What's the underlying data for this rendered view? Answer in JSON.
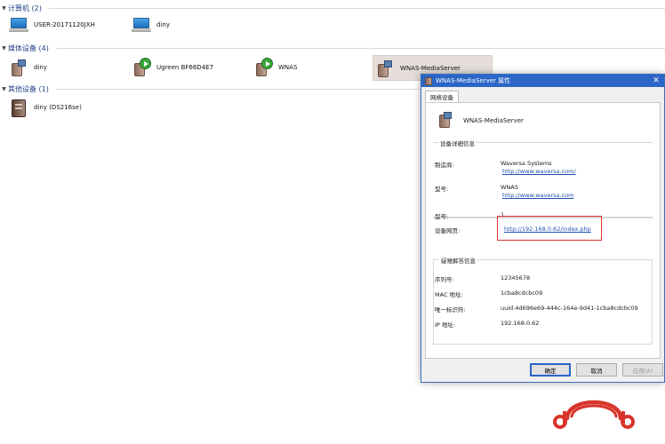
{
  "groups": [
    {
      "title": "计算机 (2)"
    },
    {
      "title": "媒体设备 (4)"
    },
    {
      "title": "其他设备 (1)"
    }
  ],
  "computers": [
    {
      "label": "USER-20171120JXH"
    },
    {
      "label": "diny"
    }
  ],
  "media_devices": [
    {
      "label": "diny"
    },
    {
      "label": "Ugreen BF66D4E7"
    },
    {
      "label": "WNAS"
    },
    {
      "label": "WNAS-MediaServer"
    }
  ],
  "other_devices": [
    {
      "label": "diny (DS216se)"
    }
  ],
  "dialog": {
    "title": "WNAS-MediaServer 属性",
    "close": "✕",
    "tab": "网络设备",
    "device_name": "WNAS-MediaServer",
    "details_title": "设备详细信息",
    "manufacturer_label": "制造商:",
    "manufacturer_value": "Waversa Systems",
    "manufacturer_url": "http://www.waversa.com/",
    "model_label": "型号:",
    "model_value": "WNAS",
    "model_url": "http://www.waversa.com",
    "model_number_label": "型号:",
    "model_number_value": "1",
    "webpage_label": "设备网页:",
    "webpage_url": "http://192.168.0.62/index.php",
    "troubleshoot_title": "疑难解答信息",
    "serial_label": "序列号:",
    "serial_value": "12345678",
    "mac_label": "MAC 地址:",
    "mac_value": "1cba8cdcbc09",
    "uid_label": "唯一标识符:",
    "uid_value": "uuid:4d696e69-444c-164e-9d41-1cba8cdcbc09",
    "ip_label": "IP 地址:",
    "ip_value": "192.168.0.62",
    "ok": "确定",
    "cancel": "取消",
    "apply": "应用(A)"
  },
  "colors": {
    "accent": "#2b66c7",
    "highlight": "#d8342b",
    "selection": "#e5ddd9",
    "logo": "#d8342b"
  }
}
